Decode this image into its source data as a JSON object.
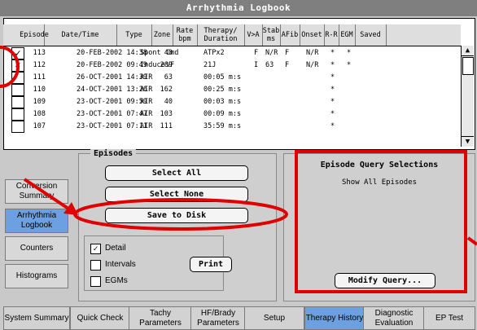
{
  "title": "Arrhythmia Logbook",
  "columns": [
    "Episode",
    "Date/Time",
    "Type",
    "Zone",
    "Rate bpm",
    "Therapy/ Duration",
    "V>A",
    "Stab ms",
    "AFib",
    "Onset",
    "R-R",
    "EGM",
    "Saved"
  ],
  "rows": [
    {
      "checked": true,
      "episode": "113",
      "datetime": "20-FEB-2002 14:38",
      "type": "Spont",
      "zone": "Cmd",
      "rate": "40",
      "therapy": "ATPx2",
      "va": "F",
      "stab": "N/R",
      "afib": "F",
      "onset": "N/R",
      "rr": "*",
      "egm": "*",
      "saved": ""
    },
    {
      "checked": true,
      "episode": "112",
      "datetime": "20-FEB-2002 09:49",
      "type": "Induce",
      "zone": "VF",
      "rate": "289",
      "therapy": "21J",
      "va": "I",
      "stab": "63",
      "afib": "F",
      "onset": "N/R",
      "rr": "*",
      "egm": "*",
      "saved": ""
    },
    {
      "checked": false,
      "episode": "111",
      "datetime": "26-OCT-2001 14:39",
      "type": "AIR",
      "zone": "",
      "rate": "63",
      "therapy": "00:05 m:s",
      "va": "",
      "stab": "",
      "afib": "",
      "onset": "",
      "rr": "*",
      "egm": "",
      "saved": ""
    },
    {
      "checked": false,
      "episode": "110",
      "datetime": "24-OCT-2001 13:26",
      "type": "AIR",
      "zone": "",
      "rate": "162",
      "therapy": "00:25 m:s",
      "va": "",
      "stab": "",
      "afib": "",
      "onset": "",
      "rr": "*",
      "egm": "",
      "saved": ""
    },
    {
      "checked": false,
      "episode": "109",
      "datetime": "23-OCT-2001 09:59",
      "type": "AIR",
      "zone": "",
      "rate": "40",
      "therapy": "00:03 m:s",
      "va": "",
      "stab": "",
      "afib": "",
      "onset": "",
      "rr": "*",
      "egm": "",
      "saved": ""
    },
    {
      "checked": false,
      "episode": "108",
      "datetime": "23-OCT-2001 07:47",
      "type": "AIR",
      "zone": "",
      "rate": "103",
      "therapy": "00:09 m:s",
      "va": "",
      "stab": "",
      "afib": "",
      "onset": "",
      "rr": "*",
      "egm": "",
      "saved": ""
    },
    {
      "checked": false,
      "episode": "107",
      "datetime": "23-OCT-2001 07:11",
      "type": "AIR",
      "zone": "",
      "rate": "111",
      "therapy": "35:59 m:s",
      "va": "",
      "stab": "",
      "afib": "",
      "onset": "",
      "rr": "*",
      "egm": "",
      "saved": ""
    }
  ],
  "episodes_panel": {
    "title": "Episodes",
    "select_all": "Select All",
    "select_none": "Select None",
    "save_to_disk": "Save to Disk",
    "print": "Print",
    "options": [
      {
        "label": "Detail",
        "checked": true
      },
      {
        "label": "Intervals",
        "checked": false
      },
      {
        "label": "EGMs",
        "checked": false
      }
    ]
  },
  "query_panel": {
    "title": "Episode Query Selections",
    "subtitle": "Show All Episodes",
    "modify": "Modify Query..."
  },
  "sidebar": [
    {
      "label": "Conversion Summary",
      "active": false
    },
    {
      "label": "Arrhythmia Logbook",
      "active": true
    },
    {
      "label": "Counters",
      "active": false
    },
    {
      "label": "Histograms",
      "active": false
    }
  ],
  "tabs": [
    {
      "label": "System Summary",
      "active": false
    },
    {
      "label": "Quick Check",
      "active": false
    },
    {
      "label": "Tachy Parameters",
      "active": false
    },
    {
      "label": "HF/Brady Parameters",
      "active": false
    },
    {
      "label": "Setup",
      "active": false
    },
    {
      "label": "Therapy History",
      "active": true
    },
    {
      "label": "Diagnostic Evaluation",
      "active": false
    },
    {
      "label": "EP Test",
      "active": false
    }
  ],
  "colors": {
    "active": "#6da0e0",
    "annotation": "#e00000"
  }
}
